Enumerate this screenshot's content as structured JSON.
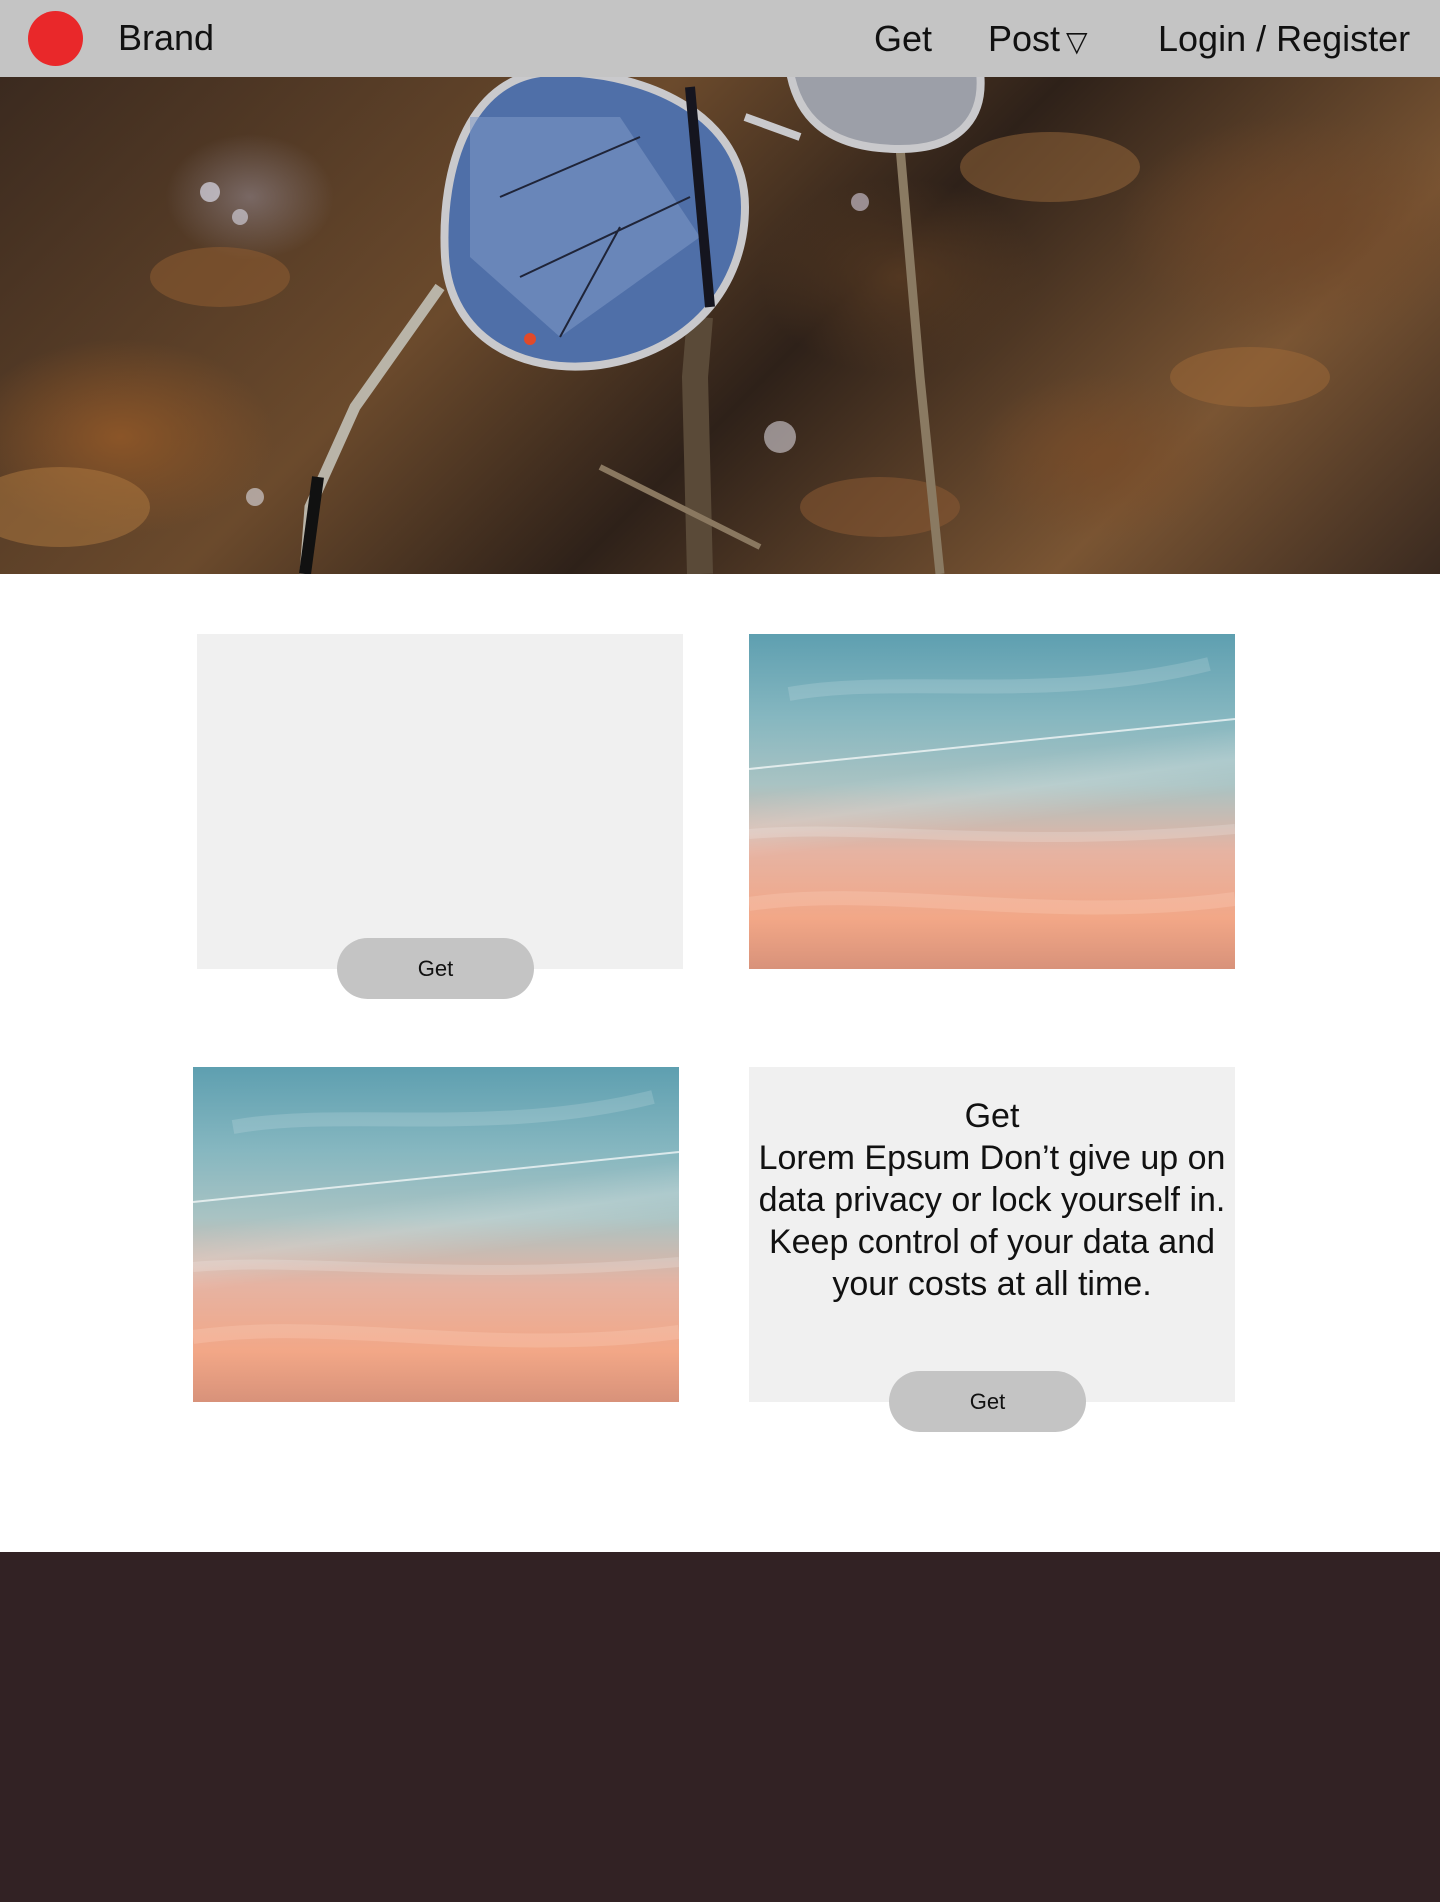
{
  "header": {
    "brand": "Brand",
    "nav": {
      "get": "Get",
      "post": "Post",
      "post_caret": "▽",
      "login": "Login / Register"
    },
    "logo_color": "#e9282a",
    "background": "#c4c4c4"
  },
  "hero": {
    "image": "sunglasses-on-branch",
    "slides": 3,
    "active_slide": 2
  },
  "cards": {
    "first": {
      "button_label": "Get"
    },
    "text_card": {
      "title": "Get",
      "body": "Lorem Epsum Don’t give up on data privacy or lock yourself in. Keep control of your data and your costs at all time.",
      "button_label": "Get"
    },
    "images": [
      "sunset-sky",
      "sunset-sky"
    ]
  },
  "footer": {
    "background": "#322224"
  }
}
